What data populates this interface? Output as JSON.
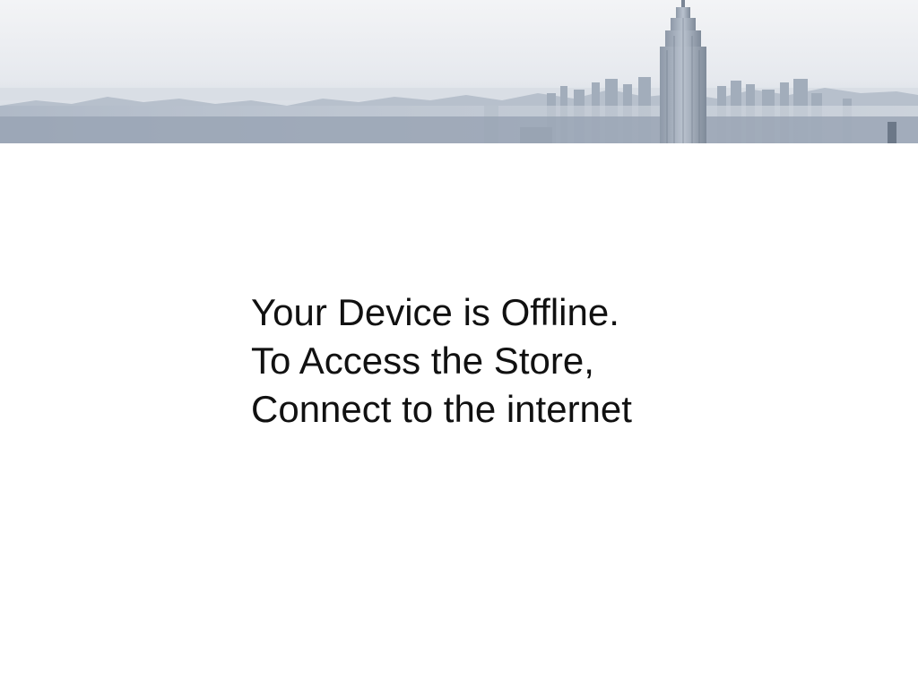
{
  "banner": {
    "image": "city-skyline-banner"
  },
  "offline_message": {
    "lines": [
      "Your Device is Offline.",
      "To Access the Store,",
      "Connect to the internet"
    ]
  },
  "colors": {
    "background": "#ffffff",
    "text": "#111111",
    "sky_top": "#eef0f3",
    "skyline": "#9aa6b6"
  }
}
